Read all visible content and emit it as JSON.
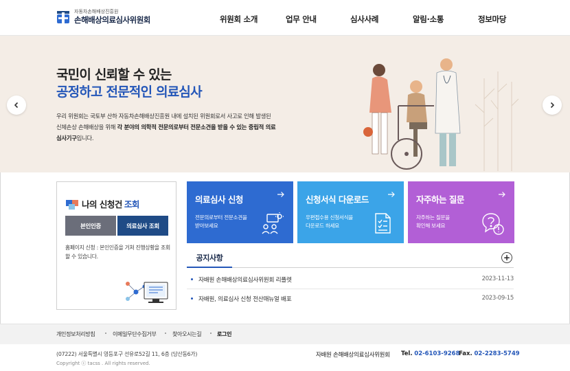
{
  "header": {
    "org_sub": "자동차손해배상진흥원",
    "org_title": "손해배상의료심사위원회",
    "nav": [
      "위원회 소개",
      "업무 안내",
      "심사사례",
      "알림·소통",
      "정보마당"
    ]
  },
  "hero": {
    "headline1": "국민이 신뢰할 수 있는",
    "headline2": "공정하고 전문적인 의료심사",
    "desc_part1": "우리 위원회는 국토부 산하 자동차손해배상진흥원 내에 설치된 위원회로서 사고로 인해 발생된 신체손상 손해배상을 위해 ",
    "desc_bold": "각 분야의 의학적 전문의로부터 전문소견을 받을 수 있는 중립적 의료심사기구",
    "desc_part2": "입니다.",
    "prev_icon": "chevron-left-icon",
    "next_icon": "chevron-right-icon"
  },
  "inquiry": {
    "title_main": "나의 신청건",
    "title_accent": "조회",
    "btn_auth": "본인인증",
    "btn_lookup": "의료심사 조회",
    "note": "홈페이지 신청 : 본인인증을 거쳐 진행상황을 조회 할 수 있습니다."
  },
  "tiles": [
    {
      "title": "의료심사 신청",
      "desc1": "전문의로부터 전문소견을",
      "desc2": "받아보세요",
      "color": "#2e6bd1",
      "icon": "consult-icon"
    },
    {
      "title": "신청서식 다운로드",
      "desc1": "우편접수용 신청서식을",
      "desc2": "다운로드 하세요",
      "color": "#3ba4e8",
      "icon": "document-list-icon"
    },
    {
      "title": "자주하는 질문",
      "desc1": "자주하는 질문을",
      "desc2": "확인해 보세요",
      "color": "#b25fd6",
      "icon": "question-bubble-icon"
    }
  ],
  "notice": {
    "tab": "공지사항",
    "more": "+",
    "items": [
      {
        "title": "자배원 손해배상의료심사위원회 리플렛",
        "date": "2023-11-13"
      },
      {
        "title": "자배원, 의료심사 신청 전산매뉴얼 배포",
        "date": "2023-09-15"
      }
    ]
  },
  "footer": {
    "links": [
      "개인정보처리방침",
      "이메일무단수집거부",
      "찾아오시는길",
      "로그인"
    ],
    "address": "(07222) 서울특별시 영등포구 선유로52길 11, 6층 (당산동6가)",
    "copyright": "Copyright ⓒ tacss . All rights reserved.",
    "org": "자배원 손해배상의료심사위원회",
    "tel_label": "Tel.",
    "tel": "02-6103-9268",
    "fax_label": "Fax.",
    "fax": "02-2283-5749"
  },
  "colors": {
    "brand_blue": "#2356b8",
    "hero_bg": "#f4ede6",
    "btn_gray": "#6b6e7a",
    "btn_navy": "#1f4b86"
  }
}
